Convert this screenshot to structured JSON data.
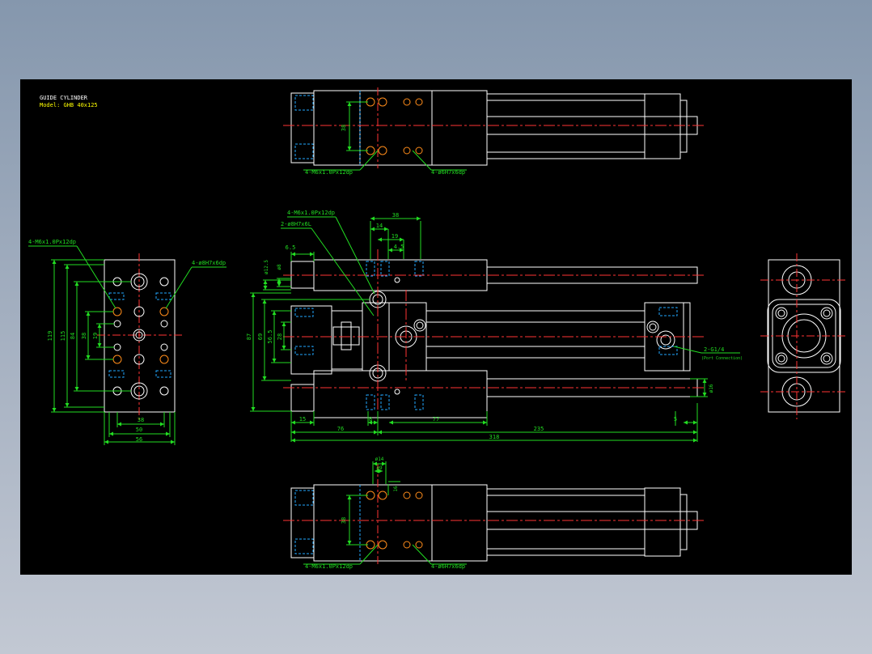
{
  "title_block": {
    "title": "GUIDE CYLINDER",
    "model": "Model: GHB 40x125"
  },
  "colors": {
    "background": "#000000",
    "outline": "#ffffff",
    "dimension": "#22dd22",
    "center_line": "#ff3333",
    "hidden_line": "#22a8ff",
    "title_text": "#ffff00",
    "hole_highlight": "#ff8c1a"
  },
  "top_view": {
    "dim_38": "38",
    "callout_tap": "4-M6x1.0Px12dp",
    "callout_pin": "4-ø6H7x6dp"
  },
  "left_view": {
    "callout_tap": "4-M6x1.0Px12dp",
    "callout_pin": "4-ø8H7x6dp",
    "dim_119": "119",
    "dim_115": "115",
    "dim_84": "84",
    "dim_38": "38",
    "dim_19": "19",
    "dim_38_bottom": "38",
    "dim_50": "50",
    "dim_56": "56"
  },
  "front_view": {
    "callout_tap": "4-M6x1.0Px12dp",
    "callout_pin": "2-ø8H7x6L",
    "dim_38": "38",
    "dim_14": "14",
    "dim_19": "19",
    "dim_4_5": "4.5",
    "dim_6_5": "6.5",
    "dim_d12_5": "ø12.5",
    "dim_d8": "ø8",
    "dim_87": "87",
    "dim_69": "69",
    "dim_56_5": "56.5",
    "dim_28": "28",
    "port_callout": "2-G1/4",
    "port_note": "(Port Connection)",
    "dim_d16": "ø16",
    "dim_15": "15",
    "dim_8": "8",
    "dim_77": "77",
    "dim_5": "5",
    "dim_76": "76",
    "dim_235": "235",
    "dim_318": "318"
  },
  "bottom_view": {
    "dim_d14": "ø14",
    "dim_d9": "ø9",
    "dim_16": "16",
    "dim_38": "38",
    "callout_tap": "4-M6x1.0Px12dp",
    "callout_pin": "4-ø6H7x6dp"
  }
}
